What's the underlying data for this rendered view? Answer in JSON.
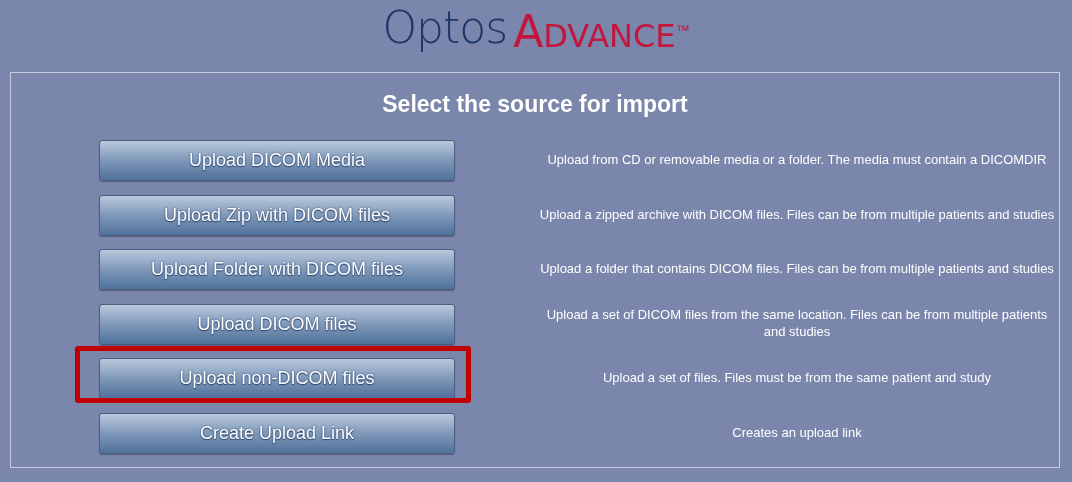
{
  "logo": {
    "brand": "Optos",
    "product": "ADVANCE",
    "trademark": "™"
  },
  "title": "Select the source for import",
  "sources": [
    {
      "button": "Upload DICOM Media",
      "description": "Upload from CD or removable media or a folder. The media must contain a DICOMDIR",
      "highlighted": false
    },
    {
      "button": "Upload Zip with DICOM files",
      "description": "Upload a zipped archive with DICOM files. Files can be from multiple patients and studies",
      "highlighted": false
    },
    {
      "button": "Upload Folder with DICOM files",
      "description": "Upload a folder that contains DICOM files. Files can be from multiple patients and studies",
      "highlighted": false
    },
    {
      "button": "Upload DICOM files",
      "description": "Upload a set of DICOM files from the same location. Files can be from multiple patients and studies",
      "highlighted": false
    },
    {
      "button": "Upload non-DICOM files",
      "description": "Upload a set of files. Files must be from the same patient and study",
      "highlighted": true
    },
    {
      "button": "Create Upload Link",
      "description": "Creates an upload link",
      "highlighted": false
    }
  ]
}
